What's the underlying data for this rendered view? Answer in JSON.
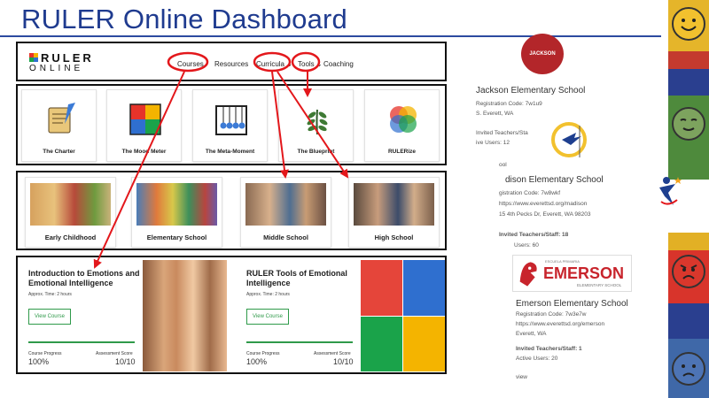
{
  "slide": {
    "title": "RULER Online Dashboard"
  },
  "logo": {
    "top": "RULER",
    "bottom": "ONLINE",
    "colors": [
      "#e6332a",
      "#f4b400",
      "#1aa34a",
      "#2f6fcf"
    ]
  },
  "nav": {
    "courses": "Courses",
    "resources": "Resources",
    "curricula": "Curricula ⌄",
    "tools": "Tools ⌄",
    "coaching": "Coaching"
  },
  "tools": [
    {
      "label": "The Charter",
      "icon": "scroll-quill-icon"
    },
    {
      "label": "The Mood Meter",
      "icon": "mood-grid-icon"
    },
    {
      "label": "The Meta-Moment",
      "icon": "newton-cradle-icon"
    },
    {
      "label": "The Blueprint",
      "icon": "laurel-icon"
    },
    {
      "label": "RULERize",
      "icon": "venn-icon"
    }
  ],
  "levels": [
    {
      "label": "Early Childhood"
    },
    {
      "label": "Elementary School"
    },
    {
      "label": "Middle School"
    },
    {
      "label": "High School"
    }
  ],
  "courses": [
    {
      "title": "Introduction to Emotions and Emotional Intelligence",
      "approx": "Approx. Time: 2 hours",
      "button": "View Course",
      "progress_label": "Course Progress",
      "progress_value": "100%",
      "score_label": "Assessment Score",
      "score_value": "10/10"
    },
    {
      "title": "RULER Tools of Emotional Intelligence",
      "approx": "Approx. Time: 2 hours",
      "button": "View Course",
      "progress_label": "Course Progress",
      "progress_value": "100%",
      "score_label": "Assessment Score",
      "score_value": "10/10"
    }
  ],
  "schools": [
    {
      "name": "Jackson Elementary School",
      "logo_text": "JACKSON",
      "line1": "Registration Code: 7w1u9",
      "line2": "S. Everett, WA",
      "line3": "Invited Teachers/Sta",
      "line4": "ive Users: 12"
    },
    {
      "name": "dison Elementary School",
      "line1": "gistration Code: 7w8wkf",
      "line2": "https://www.everettsd.org/madison",
      "line3": "15 4th Pecks Dr, Everett, WA 98203",
      "line4": "Invited Teachers/Staff: 18",
      "line5": "Users: 60",
      "line0": "ool"
    },
    {
      "name": "Emerson Elementary School",
      "logo_top": "ESCUELA PRIMARIA",
      "logo_main": "EMERSON",
      "logo_sub": "ELEMENTARY SCHOOL",
      "line1": "Registration Code: 7w3e7w",
      "line2": "https://www.everettsd.org/emerson",
      "line3": "Everett, WA",
      "line4": "Invited Teachers/Staff: 1",
      "line5": "Active Users: 20",
      "line6": "view"
    }
  ],
  "colors": {
    "annotation": "#e3171b",
    "title": "#1f3b8f",
    "course_green": "#2f9a4a"
  }
}
